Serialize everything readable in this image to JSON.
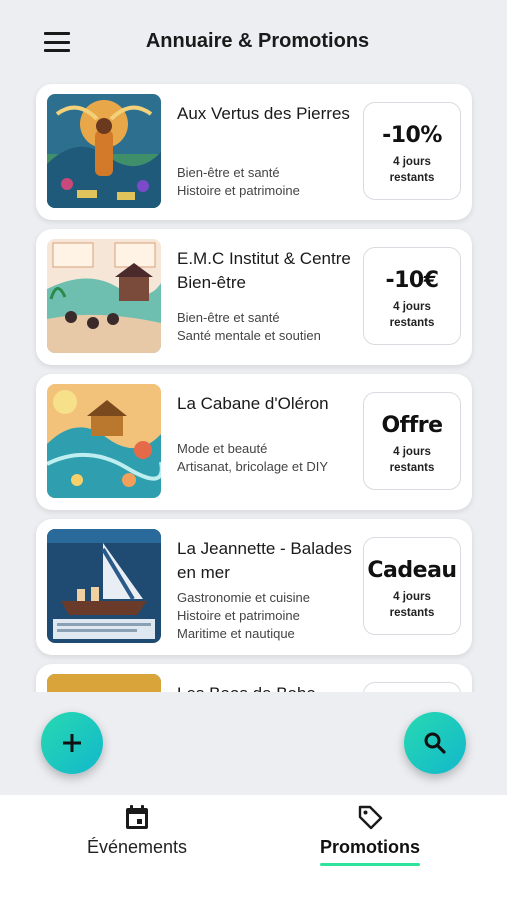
{
  "header": {
    "title": "Annuaire & Promotions"
  },
  "listings": [
    {
      "name": "Aux Vertus des Pierres",
      "categories": [
        "Bien-être et santé",
        "Histoire et patrimoine"
      ],
      "promo": "-10%",
      "remaining": "4 jours restants"
    },
    {
      "name": "E.M.C Institut & Centre Bien-être",
      "categories": [
        "Bien-être et santé",
        "Santé mentale et soutien"
      ],
      "promo": "-10€",
      "remaining": "4 jours restants"
    },
    {
      "name": "La Cabane d'Oléron",
      "categories": [
        "Mode et beauté",
        "Artisanat, bricolage et DIY"
      ],
      "promo": "Offre",
      "remaining": "4 jours restants"
    },
    {
      "name": "La Jeannette - Balades en mer",
      "categories": [
        "Gastronomie et cuisine",
        "Histoire et patrimoine",
        "Maritime et nautique"
      ],
      "promo": "Cadeau",
      "remaining": "4 jours restants"
    },
    {
      "name": "Les Baos de Baba",
      "categories": [],
      "promo": "",
      "remaining": ""
    }
  ],
  "fab": {
    "add_icon": "plus-icon",
    "search_icon": "search-icon"
  },
  "bottom_nav": {
    "items": [
      {
        "label": "Événements",
        "icon": "calendar-icon",
        "active": false
      },
      {
        "label": "Promotions",
        "icon": "tag-icon",
        "active": true
      }
    ],
    "accent": "#2ee39a"
  },
  "colors": {
    "background": "#eceef2",
    "fab_gradient_start": "#27d9b0",
    "fab_gradient_end": "#12b8cc"
  }
}
